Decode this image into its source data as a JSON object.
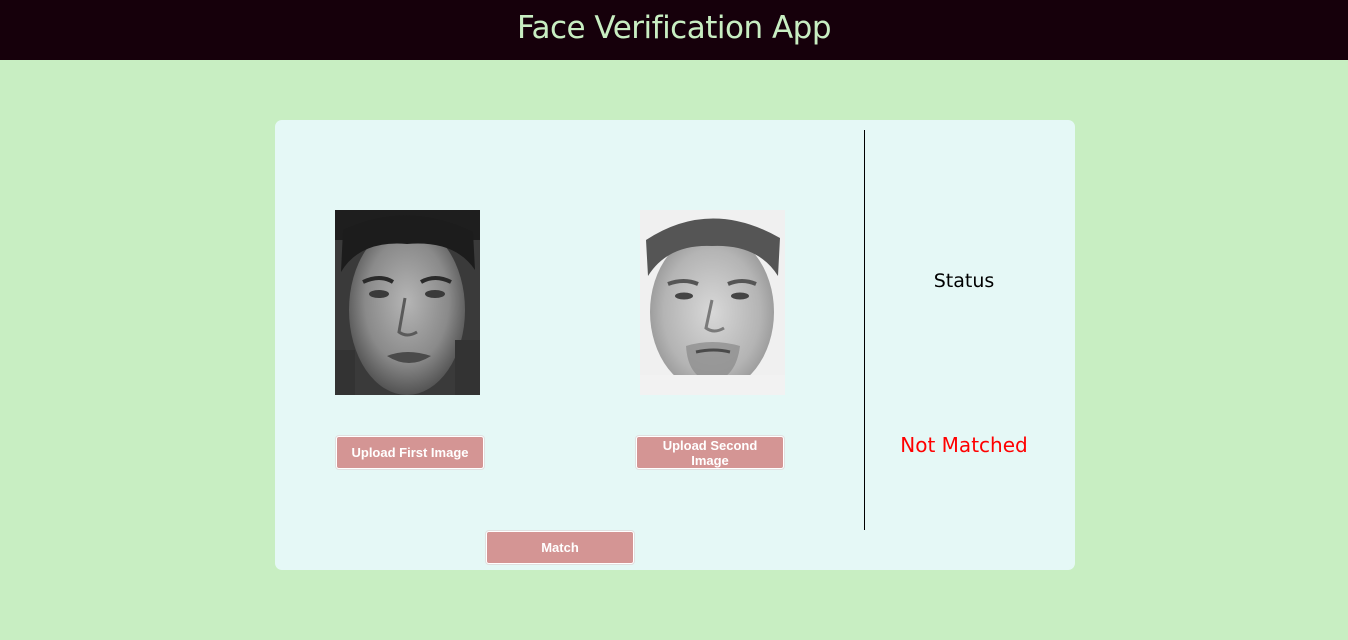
{
  "header": {
    "title": "Face Verification App"
  },
  "images": {
    "first": {
      "icon": "face-photo-1"
    },
    "second": {
      "icon": "face-photo-2"
    }
  },
  "buttons": {
    "upload_first": "Upload First Image",
    "upload_second": "Upload Second Image",
    "match": "Match"
  },
  "status": {
    "label": "Status",
    "value": "Not Matched",
    "value_color": "#ff0000"
  },
  "colors": {
    "page_bg": "#c8eec2",
    "header_bg": "#16000b",
    "header_text": "#c8eec2",
    "card_bg": "#e5f8f6",
    "button_bg": "#d49594"
  }
}
